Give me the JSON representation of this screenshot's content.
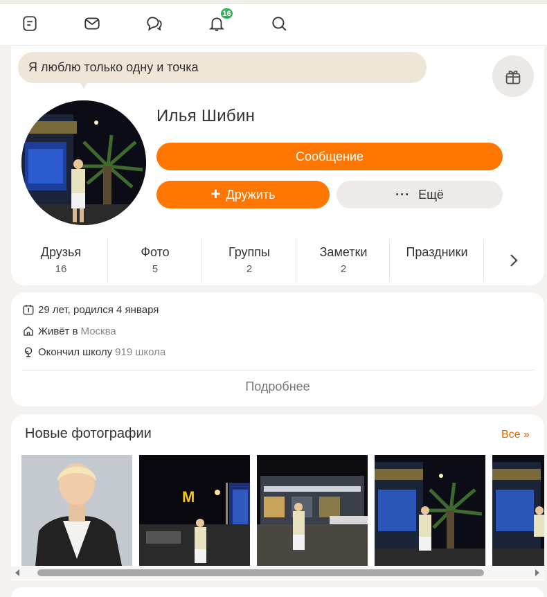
{
  "nav": {
    "items": [
      {
        "icon": "feed-icon"
      },
      {
        "icon": "mail-icon"
      },
      {
        "icon": "discussions-icon"
      },
      {
        "icon": "bell-icon",
        "badge": "16"
      },
      {
        "icon": "search-icon"
      }
    ]
  },
  "profile": {
    "status": "Я люблю только одну и точка",
    "name": "Илья Шибин",
    "message_label": "Сообщение",
    "friend_glyph": "+",
    "friend_label": "Дружить",
    "more_glyph": "···",
    "more_label": "Ещё",
    "gift_icon": "gift-icon"
  },
  "tabs": [
    {
      "label": "Друзья",
      "count": "16"
    },
    {
      "label": "Фото",
      "count": "5"
    },
    {
      "label": "Группы",
      "count": "2"
    },
    {
      "label": "Заметки",
      "count": "2"
    },
    {
      "label": "Праздники",
      "count": ""
    }
  ],
  "info": {
    "age": "29 лет, родился 4 января",
    "lives_label": "Живёт в",
    "lives_city": "Москва",
    "school_label": "Окончил школу",
    "school_name": "919 школа",
    "more_label": "Подробнее"
  },
  "photos": {
    "title": "Новые фотографии",
    "all_label": "Все »"
  },
  "colors": {
    "accent": "#ff7700",
    "badge": "#2fb35b",
    "status_bg": "#f0e6d8",
    "page_bg": "#f4f1ee"
  }
}
